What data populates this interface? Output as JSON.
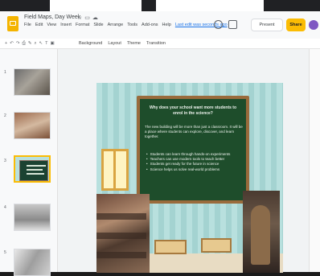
{
  "doc": {
    "title": "Field Maps, Day Week"
  },
  "menu": {
    "items": [
      "File",
      "Edit",
      "View",
      "Insert",
      "Format",
      "Slide",
      "Arrange",
      "Tools",
      "Add-ons",
      "Help"
    ],
    "edit_note": "Last edit was seconds ago"
  },
  "header": {
    "present_label": "Present",
    "share_label": "Share"
  },
  "toolbar": {
    "items": [
      "Background",
      "Layout",
      "Theme",
      "Transition"
    ]
  },
  "sidebar": {
    "slide_numbers": [
      "1",
      "2",
      "3",
      "4",
      "5"
    ]
  },
  "slide": {
    "question": "Why does your school want more students to enrol in the science?",
    "intro": "The new building will be more than just a classroom. It will be a place where students can explore, discover, and learn together.",
    "bullets": [
      "Students can learn through hands-on experiments",
      "Teachers can use modern tools to teach better",
      "Students get ready for the future in science",
      "Science helps us solve real-world problems"
    ]
  },
  "colors": {
    "accent_yellow": "#fbbc04",
    "board_green": "#1e4d2b",
    "frame_brown": "#9a6b3c",
    "wall_teal": "#b8e0de"
  },
  "icons": [
    "slides-logo-icon",
    "star-icon",
    "folder-icon",
    "cloud-icon",
    "comment-icon",
    "video-icon",
    "avatar"
  ]
}
